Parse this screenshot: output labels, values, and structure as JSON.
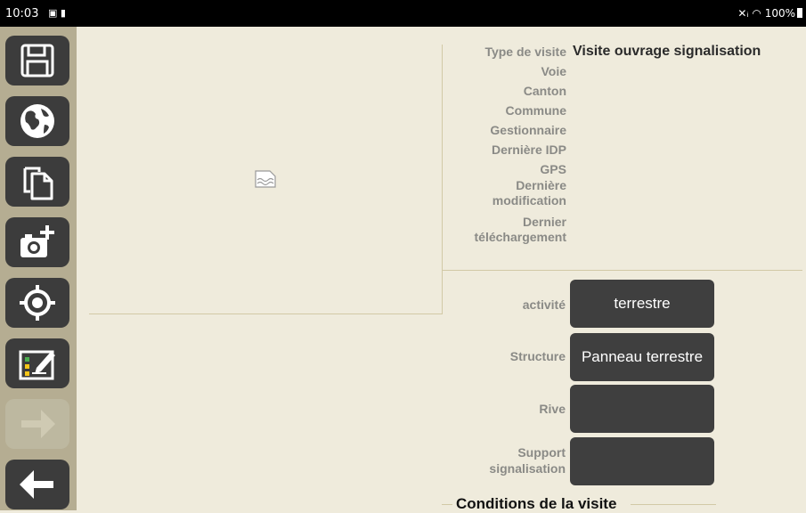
{
  "status_bar": {
    "time": "10:03",
    "left_icons": "▣ ▮",
    "right": "✕ᵢ ◠ 100%"
  },
  "sidebar": {
    "buttons": [
      {
        "name": "save",
        "icon": "save-icon"
      },
      {
        "name": "globe",
        "icon": "globe-icon"
      },
      {
        "name": "copy",
        "icon": "copy-icon"
      },
      {
        "name": "add-photo",
        "icon": "camera-plus-icon"
      },
      {
        "name": "locate",
        "icon": "target-icon"
      },
      {
        "name": "form",
        "icon": "checklist-edit-icon"
      },
      {
        "name": "forward",
        "icon": "arrow-right-icon",
        "disabled": true
      },
      {
        "name": "back",
        "icon": "arrow-left-icon"
      }
    ]
  },
  "info": {
    "rows": [
      {
        "label": "Type de visite",
        "value": "Visite ouvrage signalisation"
      },
      {
        "label": "Voie",
        "value": ""
      },
      {
        "label": "Canton",
        "value": ""
      },
      {
        "label": "Commune",
        "value": ""
      },
      {
        "label": "Gestionnaire",
        "value": ""
      },
      {
        "label": "Dernière IDP",
        "value": ""
      },
      {
        "label": "GPS",
        "value": ""
      }
    ],
    "last_modification_label_1": "Dernière",
    "last_modification_label_2": "modification",
    "last_download_label_1": "Dernier",
    "last_download_label_2": "téléchargement"
  },
  "fields": {
    "activite": {
      "label": "activité",
      "value": "terrestre"
    },
    "structure": {
      "label": "Structure",
      "value": "Panneau terrestre"
    },
    "rive": {
      "label": "Rive",
      "value": ""
    },
    "support_label_1": "Support",
    "support_label_2": "signalisation",
    "support_value": ""
  },
  "section": {
    "conditions_title": "Conditions de la visite"
  },
  "colors": {
    "background": "#efebdc",
    "sidebar": "#b5ad92",
    "button": "#3c3c3c",
    "disabled_button": "#bdb8a0",
    "label": "#8a8a86"
  }
}
